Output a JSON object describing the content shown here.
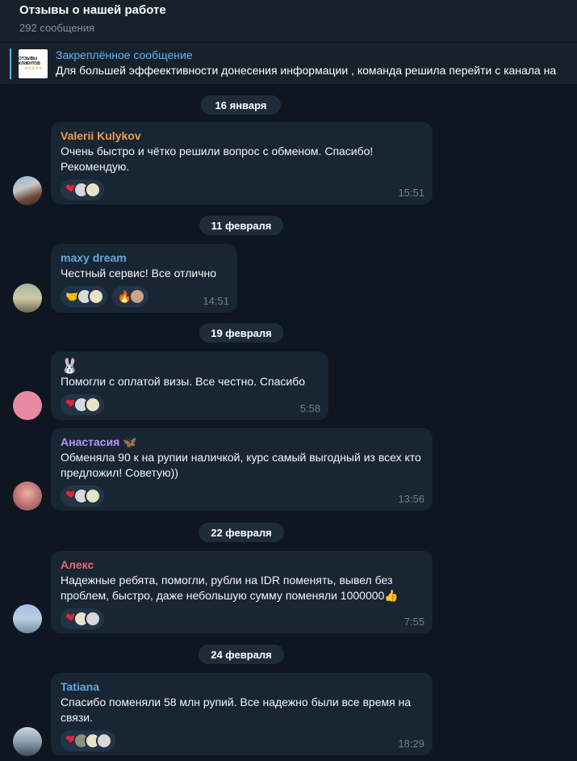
{
  "header": {
    "title": "Отзывы о нашей работе",
    "subtitle": "292 сообщения"
  },
  "pinned": {
    "label": "Закреплённое сообщение",
    "message": "Для большей эффеективности донесения информации , команда решила перейти с канала на",
    "thumb_text": "ОТЗЫВЫ КЛИЕНТОВ",
    "thumb_stars": "★★★★★"
  },
  "dates": [
    "16 января",
    "11 февраля",
    "19 февраля",
    "22 февраля",
    "24 февраля"
  ],
  "messages": [
    {
      "sender": "Valerii Kulykov",
      "sender_color": "#f29b4a",
      "text": "Очень быстро и чётко решили вопрос с обменом. Спасибо! Рекомендую.",
      "time": "15:51"
    },
    {
      "sender": "maxy dream",
      "sender_color": "#65aadd",
      "text": "Честный сервис! Все отлично",
      "time": "14:51"
    },
    {
      "sender": "",
      "sender_emoji": "🐰",
      "text": "Помогли с оплатой визы. Все честно. Спасибо",
      "time": "5:58"
    },
    {
      "sender": "Анастасия",
      "sender_emoji": "🦋",
      "sender_color": "#b694f9",
      "text": "Обменяла 90 к на рупии наличкой, курс самый выгодный из всех кто предложил! Советую))",
      "time": "13:56"
    },
    {
      "sender": "Алекс",
      "sender_color": "#e56a6a",
      "text": "Надежные ребята, помогли, рубли на IDR поменять, вывел без проблем, быстро, даже небольшую сумму поменяли 1000000",
      "text_emoji": "👍",
      "time": "7:55"
    },
    {
      "sender": "Tatiana",
      "sender_color": "#65aadd",
      "text": "Спасибо поменяли 58 млн рупий. Все надежно были все время на связи.",
      "time": "18:29"
    }
  ],
  "reactions": {
    "heart": "❤",
    "handshake": "🤝",
    "fire": "🔥"
  }
}
